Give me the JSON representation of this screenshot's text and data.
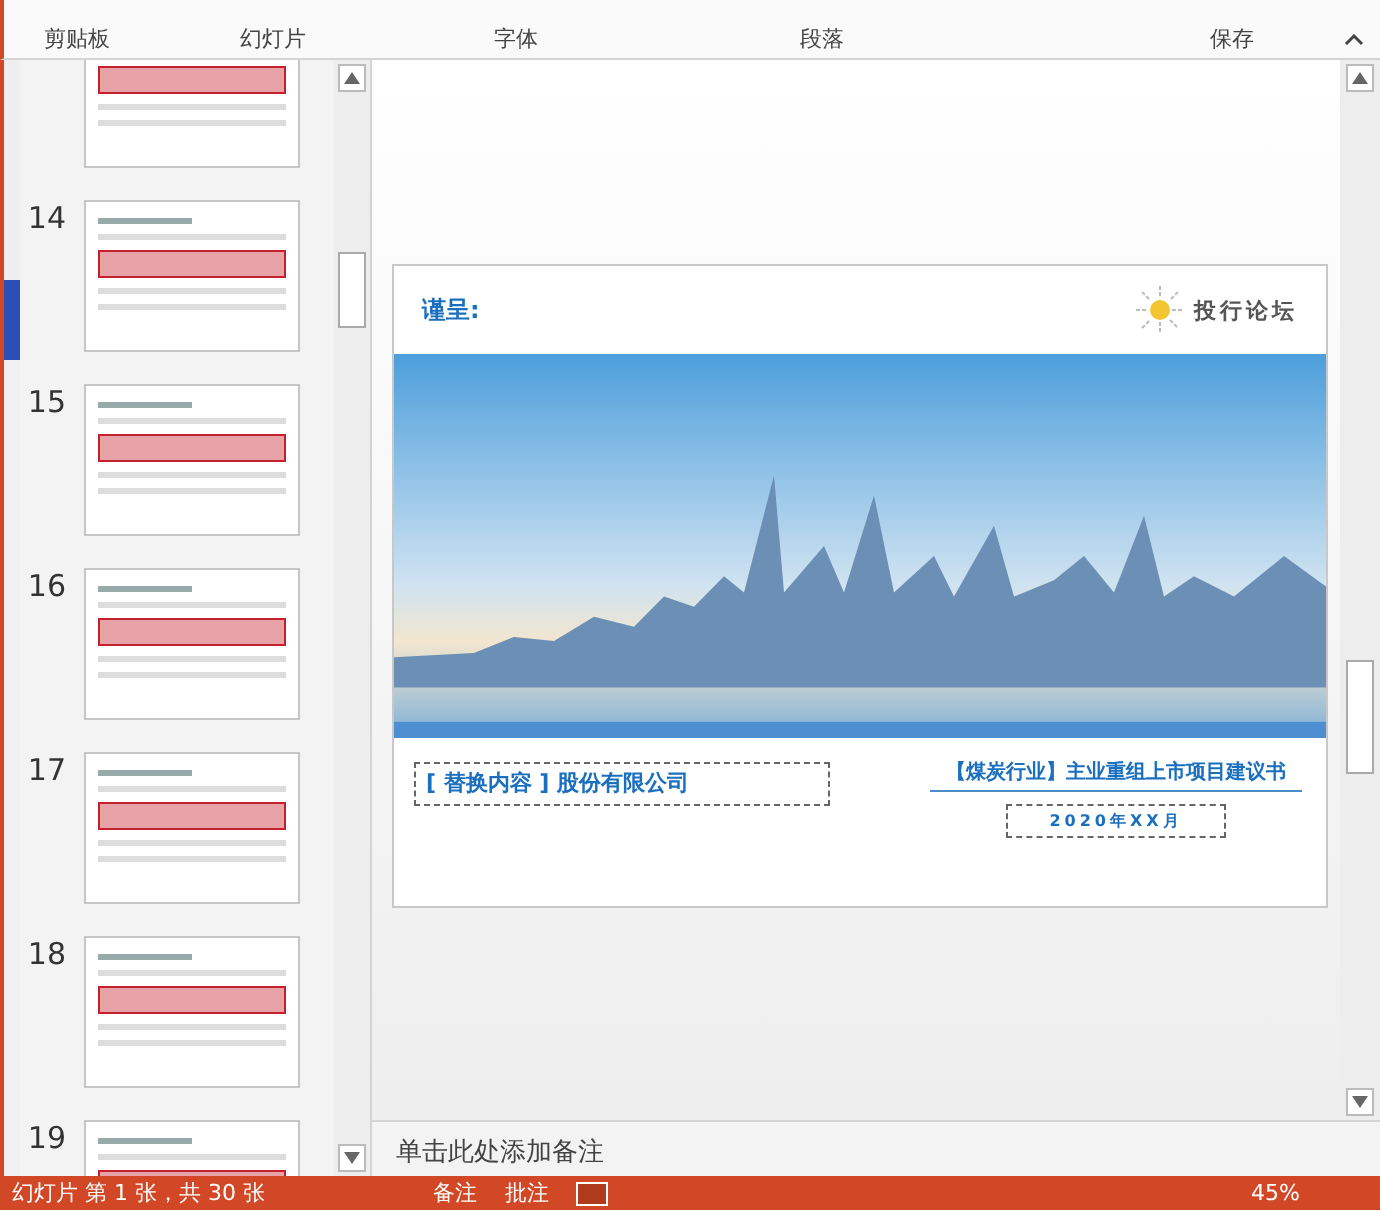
{
  "ribbon": {
    "groups": [
      "剪贴板",
      "幻灯片",
      "字体",
      "段落",
      "保存"
    ]
  },
  "thumbnails": [
    {
      "selected": false
    },
    {
      "number": "14",
      "selected": false
    },
    {
      "number": "15",
      "selected": false
    },
    {
      "number": "16",
      "selected": false
    },
    {
      "number": "17",
      "selected": false
    },
    {
      "number": "18",
      "selected": false
    },
    {
      "number": "19",
      "selected": false
    }
  ],
  "slide": {
    "greeting": "谨呈:",
    "logo_text": "投行论坛",
    "company": "[ 替换内容 ] 股份有限公司",
    "title": "【煤炭行业】主业重组上市项目建议书",
    "date": "2020年XX月"
  },
  "notes": {
    "placeholder": "单击此处添加备注"
  },
  "status_bar": {
    "slide_info": "幻灯片 第 1 张，共 30 张",
    "notes_button": "备注",
    "comments_button": "批注",
    "zoom": "45%"
  }
}
